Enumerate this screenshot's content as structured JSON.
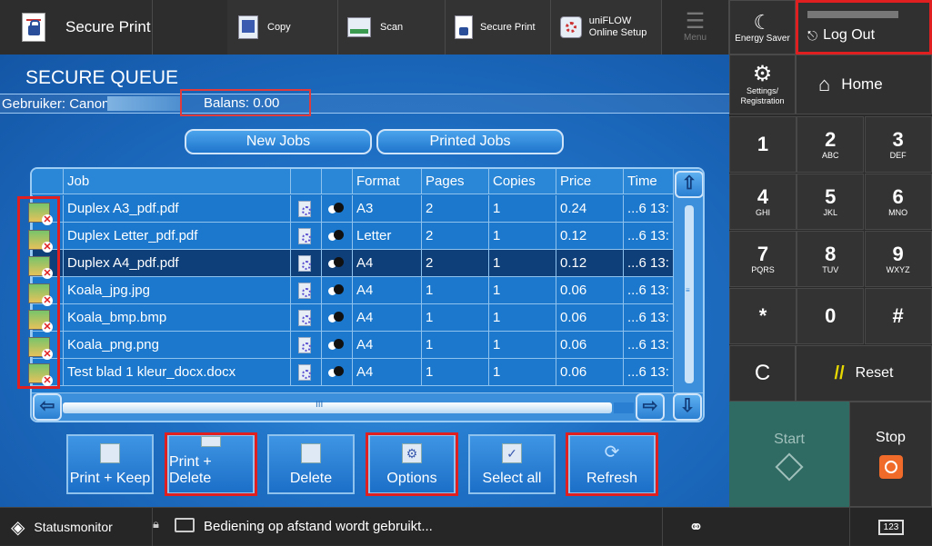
{
  "topbar": {
    "app_title": "Secure Print",
    "items": [
      {
        "label": "Copy"
      },
      {
        "label": "Scan"
      },
      {
        "label": "Secure Print"
      },
      {
        "label": "uniFLOW Online Setup"
      },
      {
        "label": "Menu"
      }
    ]
  },
  "right": {
    "energy_saver": "Energy Saver",
    "logout": "Log Out",
    "settings": "Settings/ Registration",
    "home": "Home",
    "keys": [
      {
        "d": "1",
        "s": ""
      },
      {
        "d": "2",
        "s": "ABC"
      },
      {
        "d": "3",
        "s": "DEF"
      },
      {
        "d": "4",
        "s": "GHI"
      },
      {
        "d": "5",
        "s": "JKL"
      },
      {
        "d": "6",
        "s": "MNO"
      },
      {
        "d": "7",
        "s": "PQRS"
      },
      {
        "d": "8",
        "s": "TUV"
      },
      {
        "d": "9",
        "s": "WXYZ"
      },
      {
        "d": "*",
        "s": ""
      },
      {
        "d": "0",
        "s": ""
      },
      {
        "d": "#",
        "s": ""
      }
    ],
    "clear": "C",
    "reset": "Reset",
    "start": "Start",
    "stop": "Stop"
  },
  "main": {
    "title": "SECURE QUEUE",
    "user_label": "Gebruiker: Canon",
    "balance": "Balans: 0.00",
    "tabs": [
      "New Jobs",
      "Printed Jobs"
    ]
  },
  "table": {
    "headers": [
      "Job",
      "",
      "",
      "Format",
      "Pages",
      "Copies",
      "Price",
      "Time"
    ],
    "rows": [
      {
        "job": "Duplex A3_pdf.pdf",
        "format": "A3",
        "pages": "2",
        "copies": "1",
        "price": "0.24",
        "time": "...6 13:"
      },
      {
        "job": "Duplex Letter_pdf.pdf",
        "format": "Letter",
        "pages": "2",
        "copies": "1",
        "price": "0.12",
        "time": "...6 13:"
      },
      {
        "job": "Duplex A4_pdf.pdf",
        "format": "A4",
        "pages": "2",
        "copies": "1",
        "price": "0.12",
        "time": "...6 13:"
      },
      {
        "job": "Koala_jpg.jpg",
        "format": "A4",
        "pages": "1",
        "copies": "1",
        "price": "0.06",
        "time": "...6 13:"
      },
      {
        "job": "Koala_bmp.bmp",
        "format": "A4",
        "pages": "1",
        "copies": "1",
        "price": "0.06",
        "time": "...6 13:"
      },
      {
        "job": "Koala_png.png",
        "format": "A4",
        "pages": "1",
        "copies": "1",
        "price": "0.06",
        "time": "...6 13:"
      },
      {
        "job": "Test blad 1 kleur_docx.docx",
        "format": "A4",
        "pages": "1",
        "copies": "1",
        "price": "0.06",
        "time": "...6 13:"
      }
    ],
    "hscroll_mark": "III"
  },
  "actions": [
    "Print + Keep",
    "Print + Delete",
    "Delete",
    "Options",
    "Select all",
    "Refresh"
  ],
  "status": {
    "monitor": "Statusmonitor",
    "message": "Bediening op afstand wordt gebruikt...",
    "kbd": "123"
  }
}
